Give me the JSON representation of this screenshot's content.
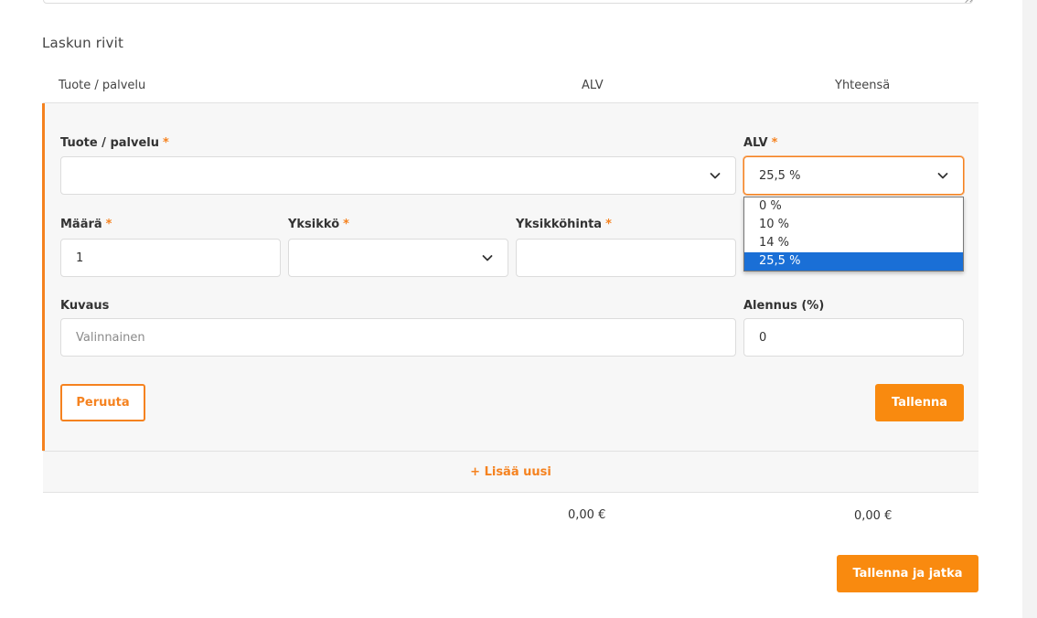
{
  "section_title": "Laskun rivit",
  "columns": {
    "product": "Tuote / palvelu",
    "vat": "ALV",
    "total": "Yhteensä"
  },
  "form": {
    "product_label": "Tuote / palvelu",
    "product_value": "",
    "vat_label": "ALV",
    "vat_value": "25,5 %",
    "vat_options": [
      "0 %",
      "10 %",
      "14 %",
      "25,5 %"
    ],
    "vat_selected_index": 3,
    "quantity_label": "Määrä",
    "quantity_value": "1",
    "unit_label": "Yksikkö",
    "unit_value": "",
    "unit_price_label": "Yksikköhinta",
    "unit_price_value": "",
    "description_label": "Kuvaus",
    "description_placeholder": "Valinnainen",
    "discount_label": "Alennus (%)",
    "discount_value": "0",
    "required_mark": "*"
  },
  "buttons": {
    "cancel": "Peruuta",
    "save": "Tallenna",
    "add_new": "+ Lisää uusi",
    "save_continue": "Tallenna ja jatka"
  },
  "totals": {
    "vat_total": "0,00 €",
    "grand_total": "0,00 €"
  },
  "colors": {
    "accent": "#f5821f",
    "selected_option": "#1a6fd6"
  }
}
